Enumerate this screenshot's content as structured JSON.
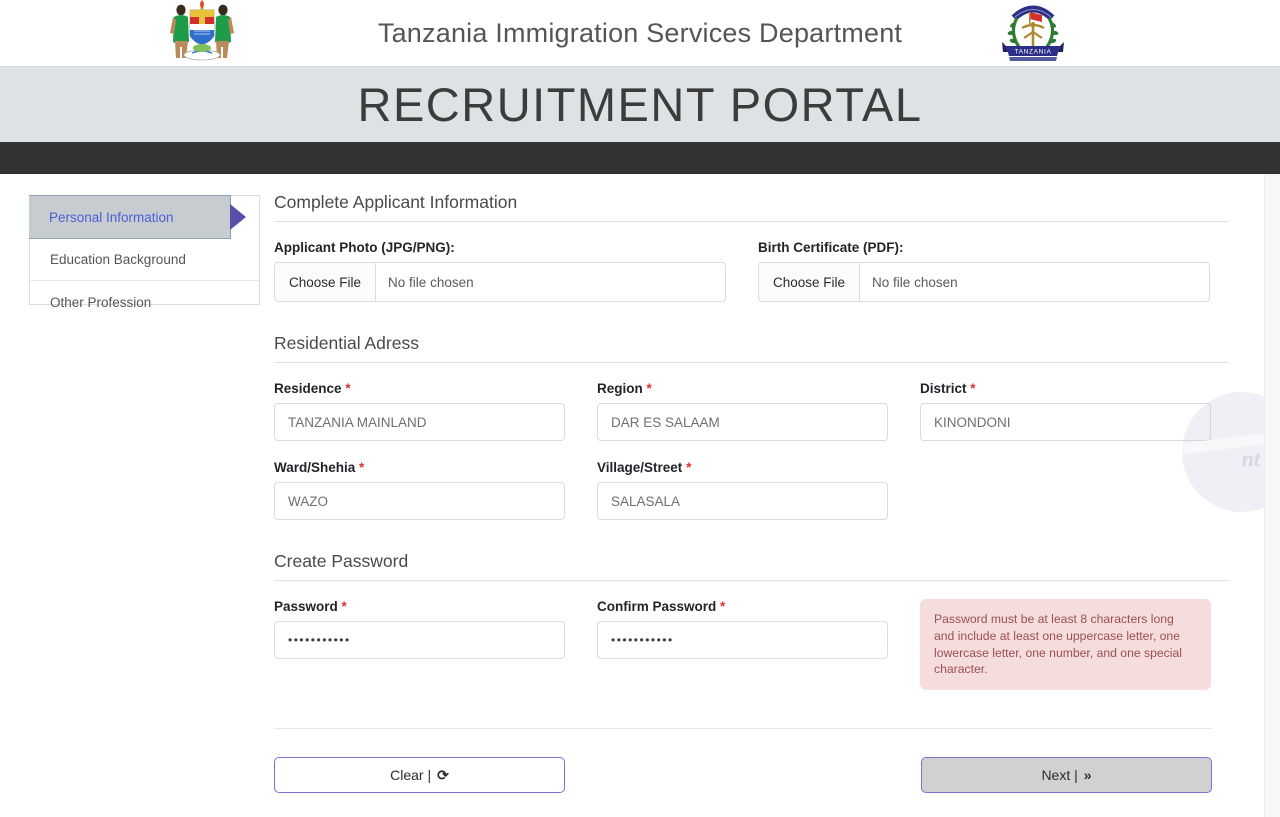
{
  "header": {
    "title": "Tanzania Immigration Services Department",
    "logo_left": "tanzania-coat-of-arms",
    "logo_right": "immigration-department-badge",
    "portal_title": "RECRUITMENT PORTAL"
  },
  "sidebar": {
    "items": [
      {
        "label": "Personal Information",
        "active": true
      },
      {
        "label": "Education Background",
        "active": false
      },
      {
        "label": "Other Profession",
        "active": false
      }
    ]
  },
  "main": {
    "sections": {
      "applicant": "Complete Applicant Information",
      "residential": "Residential Adress",
      "password": "Create Password"
    },
    "uploads": [
      {
        "label": "Applicant Photo (JPG/PNG):",
        "button": "Choose File",
        "status": "No file chosen"
      },
      {
        "label": "Birth Certificate (PDF):",
        "button": "Choose File",
        "status": "No file chosen"
      }
    ],
    "address": {
      "residence": {
        "label": "Residence",
        "required": "*",
        "value": "TANZANIA MAINLAND"
      },
      "region": {
        "label": "Region",
        "required": "*",
        "value": "DAR ES SALAAM"
      },
      "district": {
        "label": "District",
        "required": "*",
        "value": "KINONDONI"
      },
      "ward": {
        "label": "Ward/Shehia",
        "required": "*",
        "value": "WAZO"
      },
      "village": {
        "label": "Village/Street",
        "required": "*",
        "value": "SALASALA"
      }
    },
    "password": {
      "password": {
        "label": "Password",
        "required": "*",
        "value": "•••••••••••"
      },
      "confirm": {
        "label": "Confirm Password",
        "required": "*",
        "value": "•••••••••••"
      },
      "hint": "Password must be at least 8 characters long and include at least one uppercase letter, one lowercase letter, one number, and one special character."
    },
    "buttons": {
      "clear": "Clear |",
      "clear_icon": "⟳",
      "next": "Next |",
      "next_icon": "»"
    }
  },
  "colors": {
    "navbar": "#333333",
    "band": "#dde2e5",
    "accent_purple": "#5b4ea8",
    "active_link": "#4a5fd6",
    "required_red": "#e03131",
    "hint_bg": "#f6dddd"
  }
}
